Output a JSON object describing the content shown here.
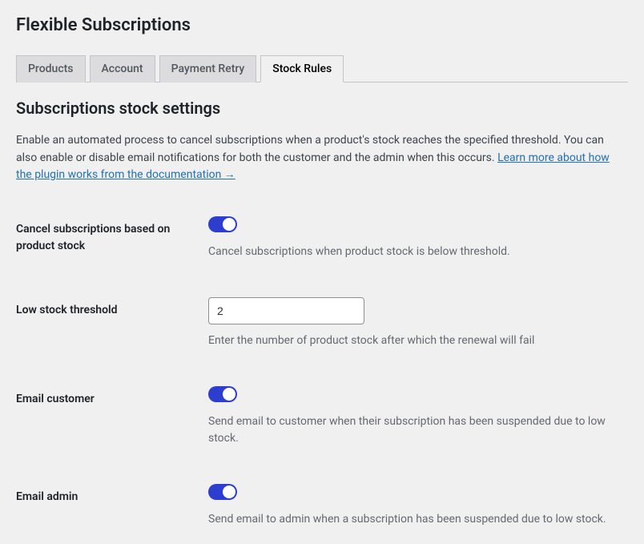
{
  "page": {
    "title": "Flexible Subscriptions"
  },
  "tabs": [
    {
      "label": "Products",
      "active": false
    },
    {
      "label": "Account",
      "active": false
    },
    {
      "label": "Payment Retry",
      "active": false
    },
    {
      "label": "Stock Rules",
      "active": true
    }
  ],
  "section": {
    "title": "Subscriptions stock settings",
    "desc_prefix": "Enable an automated process to cancel subscriptions when a product's stock reaches the specified threshold. You can also enable or disable email notifications for both the customer and the admin when this occurs. ",
    "doc_link_text": "Learn more about how the plugin works from the documentation →"
  },
  "settings": {
    "cancel_on_stock": {
      "label": "Cancel subscriptions based on product stock",
      "enabled": true,
      "desc": "Cancel subscriptions when product stock is below threshold."
    },
    "low_stock_threshold": {
      "label": "Low stock threshold",
      "value": "2",
      "desc": "Enter the number of product stock after which the renewal will fail"
    },
    "email_customer": {
      "label": "Email customer",
      "enabled": true,
      "desc": "Send email to customer when their subscription has been suspended due to low stock."
    },
    "email_admin": {
      "label": "Email admin",
      "enabled": true,
      "desc": "Send email to admin when a subscription has been suspended due to low stock."
    }
  }
}
